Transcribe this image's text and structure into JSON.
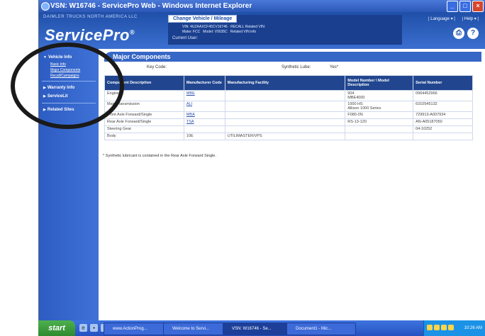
{
  "window": {
    "title": "VSN: W16746 - ServicePro Web - Windows Internet Explorer"
  },
  "header": {
    "company": "DAIMLER TRUCKS NORTH AMERICA LLC",
    "logo": "ServicePro",
    "logo_mark": "®",
    "change_vehicle": "Change Vehicle / Mileage",
    "vin_line": "VIN: 4UZAAXCF45CV16746 · RECALL Related VIN:",
    "make_label": "Make: FCC",
    "model_label": "Model: V0035C",
    "related_vin": "Related VIN info",
    "current_user": "Current User:",
    "language": "| Language ▾ |",
    "help": "| Help ▾ |"
  },
  "sidebar": {
    "sections": [
      {
        "label": "Vehicle Info",
        "items": [
          "Basic Info",
          "Major Components",
          "Recall/Campaigns"
        ]
      },
      {
        "label": "Warranty Info",
        "items": []
      },
      {
        "label": "ServiceLit",
        "items": []
      },
      {
        "label": "Related Sites",
        "items": []
      }
    ]
  },
  "main": {
    "title": "Major Components",
    "key_code_label": "Key Code:",
    "synthetic_lube_label": "Synthetic Lube:",
    "synthetic_lube_value": "Yes*",
    "columns": [
      "Component Description",
      "Manufacturer Code",
      "Manufacturing Facility",
      "Model Number \\ Model Description",
      "Serial Number"
    ],
    "rows": [
      {
        "description": "Engine",
        "code": "MBE",
        "facility": "",
        "model_line1": "904",
        "model_line2": "MBE4000",
        "serial": "0964452966"
      },
      {
        "description": "Main Transmission",
        "code": "ALI",
        "facility": "",
        "model_line1": "1000 HS",
        "model_line2": "Allison 1000 Series",
        "serial": "6310545132"
      },
      {
        "description": "Front Axle Forward/Single",
        "code": "MBA",
        "facility": "",
        "model_line1": "F080-2N",
        "model_line2": "",
        "serial": "729913-A007934"
      },
      {
        "description": "Rear Axle Forward/Single",
        "code": "TSA",
        "facility": "",
        "model_line1": "RS-13-120",
        "model_line2": "",
        "serial": "AN-A05187050"
      },
      {
        "description": "Steering Gear",
        "code": "",
        "facility": "",
        "model_line1": "",
        "model_line2": "",
        "serial": "04-10252"
      },
      {
        "description": "Body",
        "code": "10E",
        "facility": "UTILIMASTER/VPS",
        "model_line1": "",
        "model_line2": "",
        "serial": ""
      }
    ],
    "footnote": "* Synthetic lubricant is contained in the Rear Axle Forward Single."
  },
  "taskbar": {
    "start": "start",
    "tasks": [
      "www.ActionProg...",
      "Welcome to Servi...",
      "VSN: W16746 - Se...",
      "Document1 - Mic..."
    ],
    "clock": "10:26 AM"
  }
}
